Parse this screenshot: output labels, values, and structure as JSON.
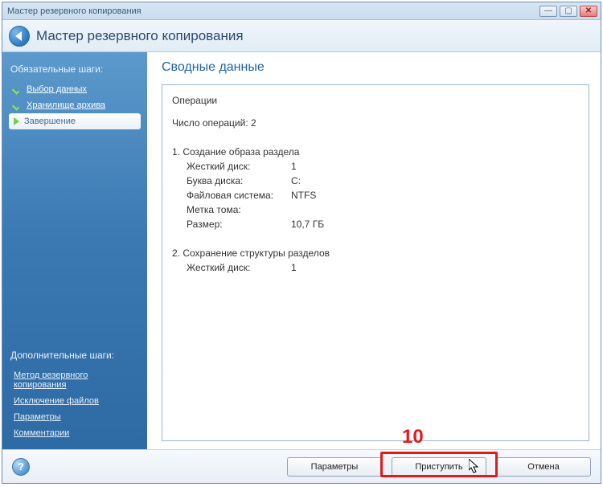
{
  "window": {
    "title": "Мастер резервного копирования"
  },
  "header": {
    "title": "Мастер резервного копирования"
  },
  "sidebar": {
    "required_title": "Обязательные шаги:",
    "required": [
      {
        "label": "Выбор данных"
      },
      {
        "label": "Хранилище архива"
      },
      {
        "label": "Завершение"
      }
    ],
    "extra_title": "Дополнительные шаги:",
    "extra": [
      {
        "label": "Метод резервного копирования"
      },
      {
        "label": "Исключение файлов"
      },
      {
        "label": "Параметры"
      },
      {
        "label": "Комментарии"
      }
    ]
  },
  "content": {
    "title": "Сводные данные",
    "ops_heading": "Операции",
    "ops_count_label": "Число операций:",
    "ops_count_value": "2",
    "op1": {
      "title": "1. Создание образа раздела",
      "rows": [
        {
          "k": "Жесткий диск:",
          "v": "1"
        },
        {
          "k": "Буква диска:",
          "v": "C:"
        },
        {
          "k": "Файловая система:",
          "v": "NTFS"
        },
        {
          "k": "Метка тома:",
          "v": ""
        },
        {
          "k": "Размер:",
          "v": "10,7 ГБ"
        }
      ]
    },
    "op2": {
      "title": "2. Сохранение структуры разделов",
      "rows": [
        {
          "k": "Жесткий диск:",
          "v": "1"
        }
      ]
    }
  },
  "footer": {
    "params": "Параметры",
    "proceed": "Приступить",
    "cancel": "Отмена"
  },
  "annotation": {
    "num": "10"
  }
}
